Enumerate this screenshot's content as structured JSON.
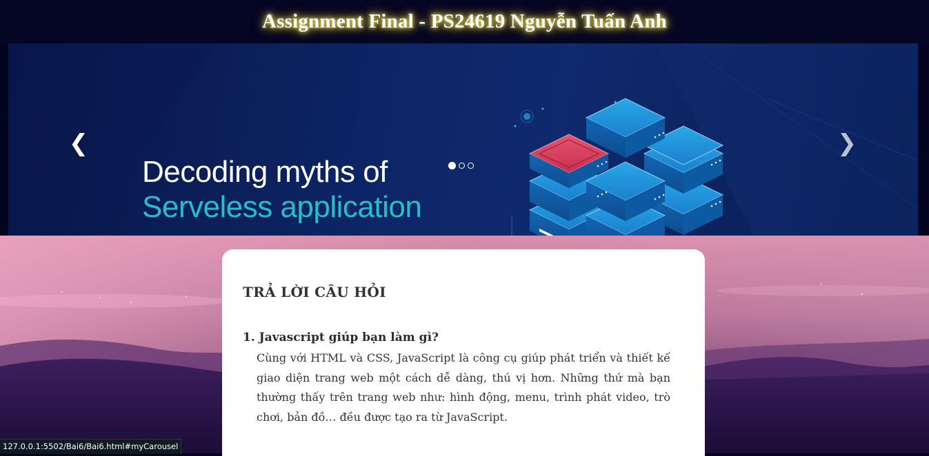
{
  "header": {
    "title": "Assignment Final - PS24619 Nguyễn Tuấn Anh"
  },
  "carousel": {
    "slide_line1": "Decoding myths of",
    "slide_line2": "Serveless application",
    "prev_icon": "chevron-left-icon",
    "next_icon": "chevron-right-icon",
    "indicator_count": 3,
    "active_index": 0
  },
  "content": {
    "heading": "TRẢ LỜI CÂU HỎI",
    "questions": [
      {
        "title": "1. Javascript giúp bạn làm gì?",
        "answer": "Cùng với HTML và CSS, JavaScript là công cụ giúp phát triển và thiết kế giao diện trang web một cách dễ dàng, thú vị hơn. Những thứ mà bạn thường thấy trên trang web như: hình động, menu, trình phát video, trò chơi, bản đồ… đều được tạo ra từ JavaScript."
      }
    ]
  },
  "statusbar": {
    "url": "127.0.0.1:5502/Bai6/Bai6.html#myCarousel"
  },
  "colors": {
    "header_bg": "#050524",
    "title_glow": "#f2e66a",
    "carousel_bg": "#0d2566",
    "slide_accent": "#26bfc7",
    "server_blue": "#1e8fd6",
    "server_red": "#e0415f",
    "sky_pink": "#e59ab8",
    "mountain_purple": "#2a1550"
  }
}
